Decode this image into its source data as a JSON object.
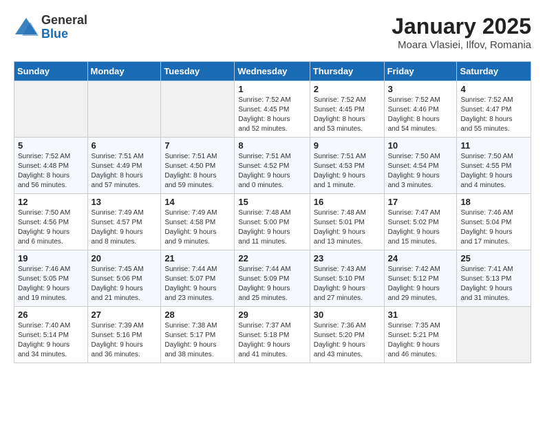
{
  "header": {
    "logo_general": "General",
    "logo_blue": "Blue",
    "month": "January 2025",
    "location": "Moara Vlasiei, Ilfov, Romania"
  },
  "days_of_week": [
    "Sunday",
    "Monday",
    "Tuesday",
    "Wednesday",
    "Thursday",
    "Friday",
    "Saturday"
  ],
  "weeks": [
    [
      {
        "day": "",
        "info": ""
      },
      {
        "day": "",
        "info": ""
      },
      {
        "day": "",
        "info": ""
      },
      {
        "day": "1",
        "info": "Sunrise: 7:52 AM\nSunset: 4:45 PM\nDaylight: 8 hours\nand 52 minutes."
      },
      {
        "day": "2",
        "info": "Sunrise: 7:52 AM\nSunset: 4:45 PM\nDaylight: 8 hours\nand 53 minutes."
      },
      {
        "day": "3",
        "info": "Sunrise: 7:52 AM\nSunset: 4:46 PM\nDaylight: 8 hours\nand 54 minutes."
      },
      {
        "day": "4",
        "info": "Sunrise: 7:52 AM\nSunset: 4:47 PM\nDaylight: 8 hours\nand 55 minutes."
      }
    ],
    [
      {
        "day": "5",
        "info": "Sunrise: 7:52 AM\nSunset: 4:48 PM\nDaylight: 8 hours\nand 56 minutes."
      },
      {
        "day": "6",
        "info": "Sunrise: 7:51 AM\nSunset: 4:49 PM\nDaylight: 8 hours\nand 57 minutes."
      },
      {
        "day": "7",
        "info": "Sunrise: 7:51 AM\nSunset: 4:50 PM\nDaylight: 8 hours\nand 59 minutes."
      },
      {
        "day": "8",
        "info": "Sunrise: 7:51 AM\nSunset: 4:52 PM\nDaylight: 9 hours\nand 0 minutes."
      },
      {
        "day": "9",
        "info": "Sunrise: 7:51 AM\nSunset: 4:53 PM\nDaylight: 9 hours\nand 1 minute."
      },
      {
        "day": "10",
        "info": "Sunrise: 7:50 AM\nSunset: 4:54 PM\nDaylight: 9 hours\nand 3 minutes."
      },
      {
        "day": "11",
        "info": "Sunrise: 7:50 AM\nSunset: 4:55 PM\nDaylight: 9 hours\nand 4 minutes."
      }
    ],
    [
      {
        "day": "12",
        "info": "Sunrise: 7:50 AM\nSunset: 4:56 PM\nDaylight: 9 hours\nand 6 minutes."
      },
      {
        "day": "13",
        "info": "Sunrise: 7:49 AM\nSunset: 4:57 PM\nDaylight: 9 hours\nand 8 minutes."
      },
      {
        "day": "14",
        "info": "Sunrise: 7:49 AM\nSunset: 4:58 PM\nDaylight: 9 hours\nand 9 minutes."
      },
      {
        "day": "15",
        "info": "Sunrise: 7:48 AM\nSunset: 5:00 PM\nDaylight: 9 hours\nand 11 minutes."
      },
      {
        "day": "16",
        "info": "Sunrise: 7:48 AM\nSunset: 5:01 PM\nDaylight: 9 hours\nand 13 minutes."
      },
      {
        "day": "17",
        "info": "Sunrise: 7:47 AM\nSunset: 5:02 PM\nDaylight: 9 hours\nand 15 minutes."
      },
      {
        "day": "18",
        "info": "Sunrise: 7:46 AM\nSunset: 5:04 PM\nDaylight: 9 hours\nand 17 minutes."
      }
    ],
    [
      {
        "day": "19",
        "info": "Sunrise: 7:46 AM\nSunset: 5:05 PM\nDaylight: 9 hours\nand 19 minutes."
      },
      {
        "day": "20",
        "info": "Sunrise: 7:45 AM\nSunset: 5:06 PM\nDaylight: 9 hours\nand 21 minutes."
      },
      {
        "day": "21",
        "info": "Sunrise: 7:44 AM\nSunset: 5:07 PM\nDaylight: 9 hours\nand 23 minutes."
      },
      {
        "day": "22",
        "info": "Sunrise: 7:44 AM\nSunset: 5:09 PM\nDaylight: 9 hours\nand 25 minutes."
      },
      {
        "day": "23",
        "info": "Sunrise: 7:43 AM\nSunset: 5:10 PM\nDaylight: 9 hours\nand 27 minutes."
      },
      {
        "day": "24",
        "info": "Sunrise: 7:42 AM\nSunset: 5:12 PM\nDaylight: 9 hours\nand 29 minutes."
      },
      {
        "day": "25",
        "info": "Sunrise: 7:41 AM\nSunset: 5:13 PM\nDaylight: 9 hours\nand 31 minutes."
      }
    ],
    [
      {
        "day": "26",
        "info": "Sunrise: 7:40 AM\nSunset: 5:14 PM\nDaylight: 9 hours\nand 34 minutes."
      },
      {
        "day": "27",
        "info": "Sunrise: 7:39 AM\nSunset: 5:16 PM\nDaylight: 9 hours\nand 36 minutes."
      },
      {
        "day": "28",
        "info": "Sunrise: 7:38 AM\nSunset: 5:17 PM\nDaylight: 9 hours\nand 38 minutes."
      },
      {
        "day": "29",
        "info": "Sunrise: 7:37 AM\nSunset: 5:18 PM\nDaylight: 9 hours\nand 41 minutes."
      },
      {
        "day": "30",
        "info": "Sunrise: 7:36 AM\nSunset: 5:20 PM\nDaylight: 9 hours\nand 43 minutes."
      },
      {
        "day": "31",
        "info": "Sunrise: 7:35 AM\nSunset: 5:21 PM\nDaylight: 9 hours\nand 46 minutes."
      },
      {
        "day": "",
        "info": ""
      }
    ]
  ]
}
